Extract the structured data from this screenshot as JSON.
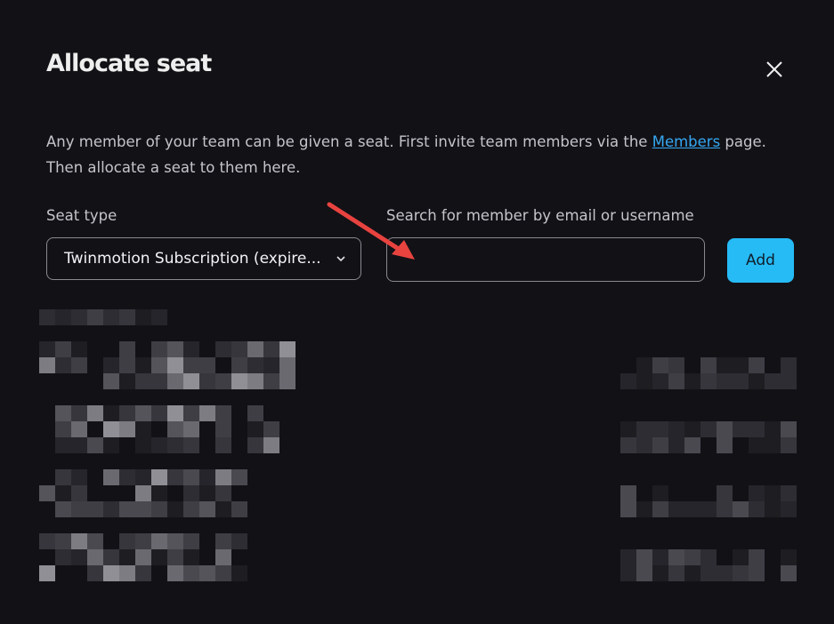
{
  "dialog": {
    "title": "Allocate seat",
    "description_part1": "Any member of your team can be given a seat. First invite team members via the ",
    "members_link": "Members",
    "description_part2": " page. Then allocate a seat to them here."
  },
  "form": {
    "seat_type_label": "Seat type",
    "seat_type_value": "Twinmotion Subscription (expire...",
    "search_label": "Search for member by email or username",
    "search_value": "",
    "search_placeholder": "",
    "add_label": "Add"
  },
  "icons": {
    "close": "close-icon",
    "chevron": "chevron-down-icon",
    "annotation": "red-arrow-annotation"
  },
  "colors": {
    "background": "#121116",
    "accent": "#26bbf5",
    "link": "#35a8f2",
    "annotation_arrow": "#e8433f"
  }
}
